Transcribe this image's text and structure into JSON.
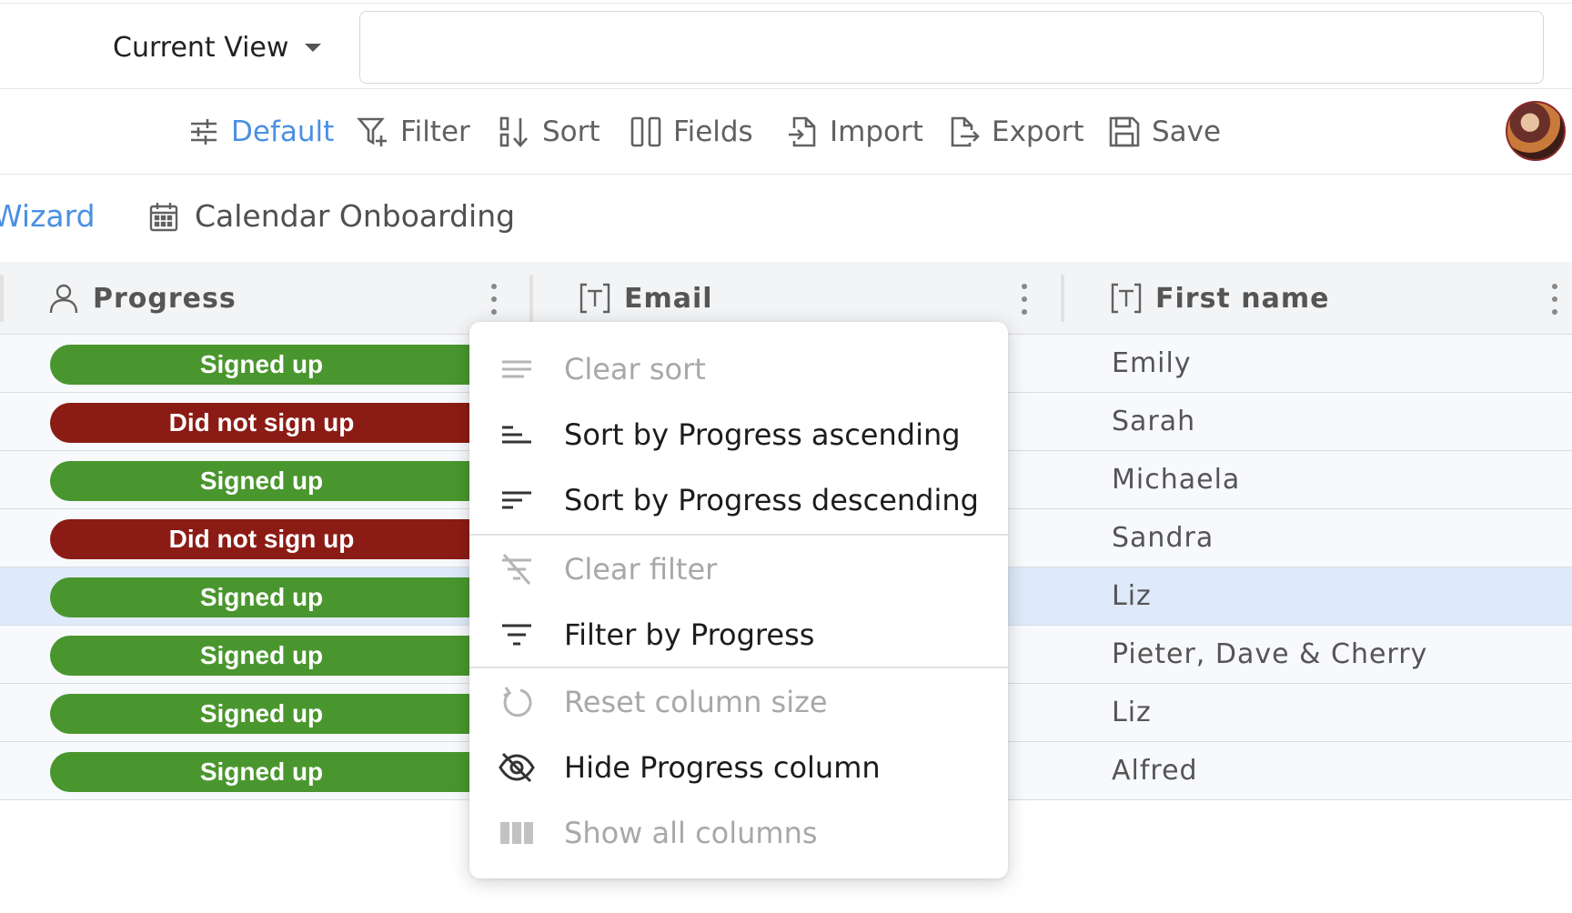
{
  "view": {
    "label": "Current View",
    "search_value": ""
  },
  "toolbar": {
    "default_label": "Default",
    "filter_label": "Filter",
    "sort_label": "Sort",
    "fields_label": "Fields",
    "import_label": "Import",
    "export_label": "Export",
    "save_label": "Save",
    "active_color": "#4a90e2"
  },
  "tabs": {
    "wizard_label": "Wizard",
    "calendar_label": "Calendar Onboarding"
  },
  "columns": [
    {
      "label": "Progress",
      "icon": "person-icon"
    },
    {
      "label": "Email",
      "icon": "text-field-icon"
    },
    {
      "label": "First name",
      "icon": "text-field-icon"
    }
  ],
  "rows": [
    {
      "progress": "Signed up",
      "status": "green",
      "first_name": "Emily"
    },
    {
      "progress": "Did not sign up",
      "status": "red",
      "first_name": "Sarah"
    },
    {
      "progress": "Signed up",
      "status": "green",
      "first_name": "Michaela"
    },
    {
      "progress": "Did not sign up",
      "status": "red",
      "first_name": "Sandra"
    },
    {
      "progress": "Signed up",
      "status": "green",
      "first_name": "Liz"
    },
    {
      "progress": "Signed up",
      "status": "green",
      "first_name": "Pieter, Dave & Cherry"
    },
    {
      "progress": "Signed up",
      "status": "green",
      "first_name": "Liz"
    },
    {
      "progress": "Signed up",
      "status": "green",
      "first_name": "Alfred"
    }
  ],
  "status_colors": {
    "green": "#4a962e",
    "red": "#8b1c15"
  },
  "menu": {
    "clear_sort": "Clear sort",
    "sort_asc": "Sort by Progress ascending",
    "sort_desc": "Sort by Progress descending",
    "clear_filter": "Clear filter",
    "filter_by": "Filter by Progress",
    "reset_size": "Reset column size",
    "hide_column": "Hide Progress column",
    "show_all": "Show all columns"
  }
}
